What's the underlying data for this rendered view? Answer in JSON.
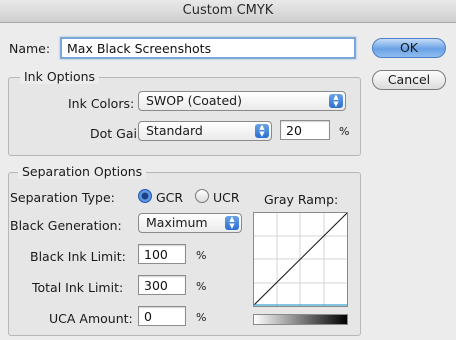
{
  "window": {
    "title": "Custom CMYK"
  },
  "name_field": {
    "label": "Name:",
    "value": "Max Black Screenshots"
  },
  "buttons": {
    "ok": "OK",
    "cancel": "Cancel"
  },
  "ink_options": {
    "title": "Ink Options",
    "ink_colors_label": "Ink Colors:",
    "ink_colors_value": "SWOP (Coated)",
    "dot_gain_label": "Dot Gain:",
    "dot_gain_value": "Standard",
    "dot_gain_amount": "20",
    "percent": "%"
  },
  "separation_options": {
    "title": "Separation Options",
    "type_label": "Separation Type:",
    "gcr_label": "GCR",
    "ucr_label": "UCR",
    "selected_type": "GCR",
    "black_generation_label": "Black Generation:",
    "black_generation_value": "Maximum",
    "black_ink_limit_label": "Black Ink Limit:",
    "black_ink_limit_value": "100",
    "total_ink_limit_label": "Total Ink Limit:",
    "total_ink_limit_value": "300",
    "uca_amount_label": "UCA Amount:",
    "uca_amount_value": "0",
    "percent": "%",
    "gray_ramp_label": "Gray Ramp:"
  },
  "icons": {
    "popup_arrows": "updown-arrows-icon",
    "radio": "radio-icon"
  },
  "colors": {
    "accent": "#3b7bd6",
    "window_bg": "#ececec"
  }
}
